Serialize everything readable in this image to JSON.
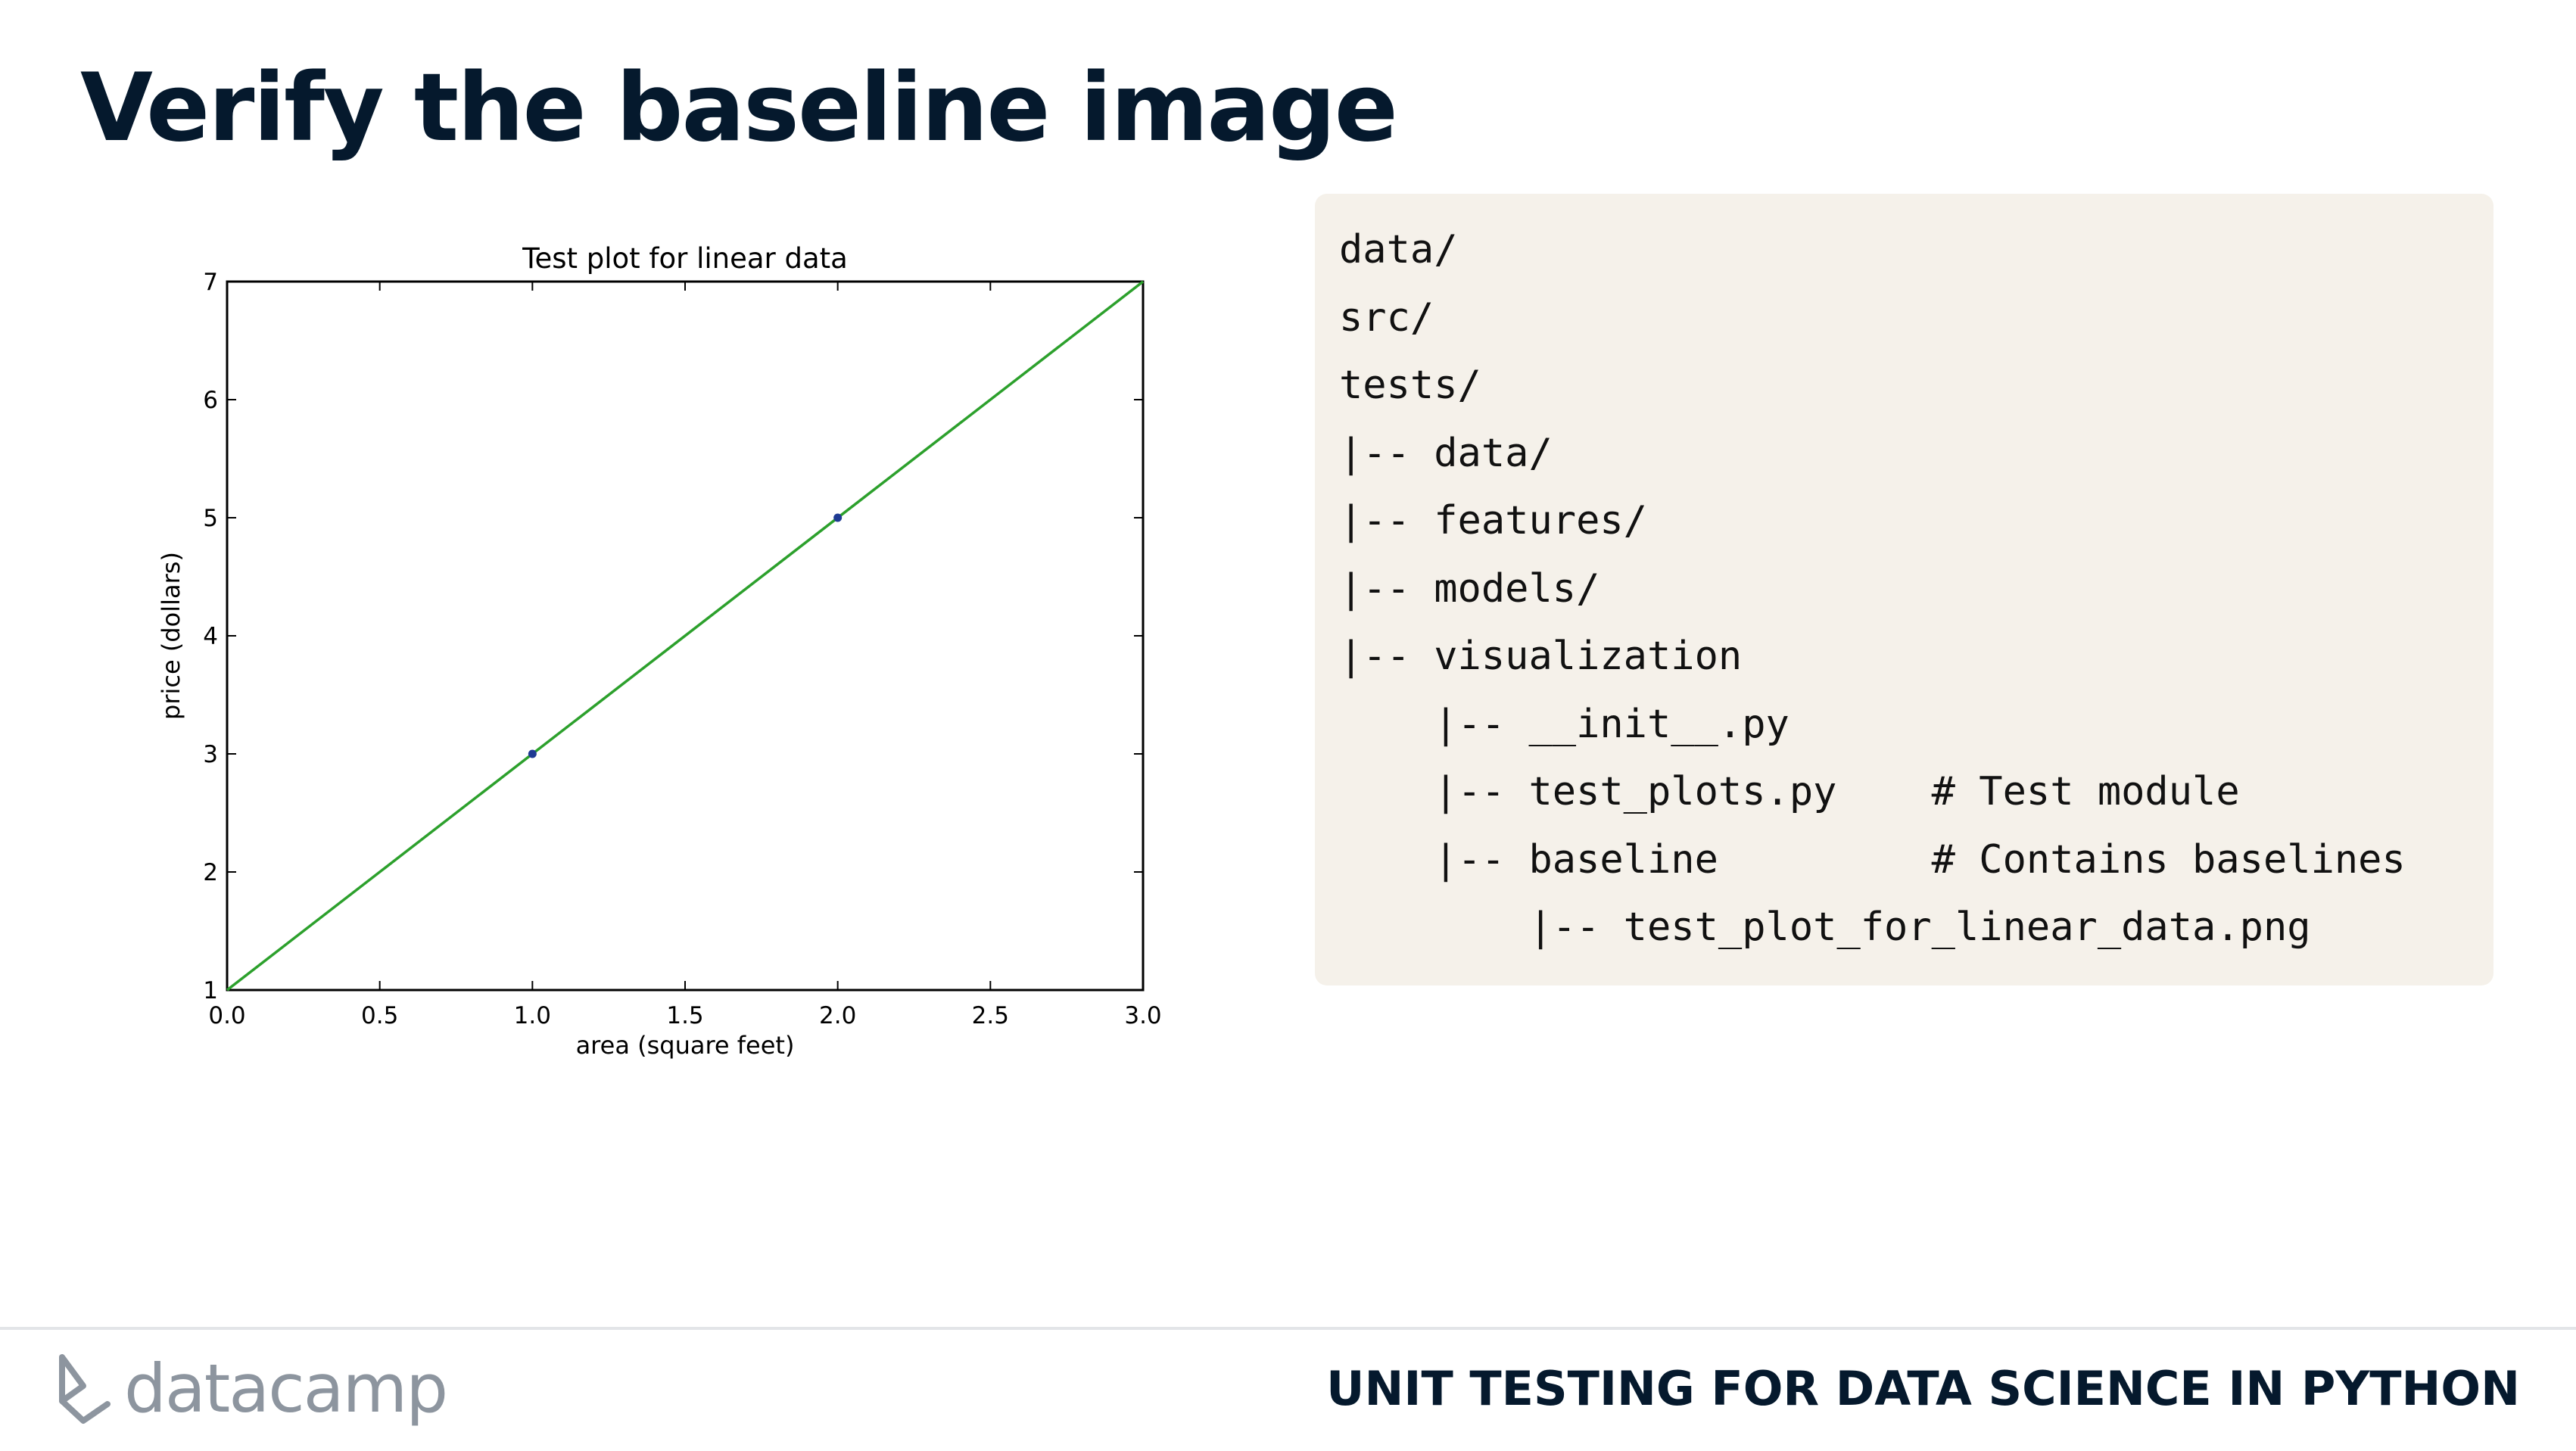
{
  "slide": {
    "title": "Verify the baseline image",
    "course_title": "UNIT TESTING FOR DATA SCIENCE IN PYTHON",
    "logo_text": "datacamp"
  },
  "code": {
    "lines": [
      "data/",
      "src/",
      "tests/",
      "|-- data/",
      "|-- features/",
      "|-- models/",
      "|-- visualization",
      "    |-- __init__.py",
      "    |-- test_plots.py    # Test module",
      "    |-- baseline         # Contains baselines",
      "        |-- test_plot_for_linear_data.png"
    ]
  },
  "colors": {
    "title": "#05192d",
    "code_background": "#f5f1ea",
    "line": "#2ca02c",
    "points": "#1f3a93",
    "logo": "#8d959f"
  },
  "chart_data": {
    "type": "line",
    "title": "Test plot for linear data",
    "xlabel": "area (square feet)",
    "ylabel": "price (dollars)",
    "xlim": [
      0,
      3
    ],
    "ylim": [
      1,
      7
    ],
    "x_ticks": [
      "0.0",
      "0.5",
      "1.0",
      "1.5",
      "2.0",
      "2.5",
      "3.0"
    ],
    "y_ticks": [
      "1",
      "2",
      "3",
      "4",
      "5",
      "6",
      "7"
    ],
    "grid": false,
    "series": [
      {
        "type": "line",
        "x": [
          0,
          3
        ],
        "y": [
          1,
          7
        ],
        "color": "#2ca02c"
      },
      {
        "type": "scatter",
        "x": [
          1,
          2
        ],
        "y": [
          3,
          5
        ],
        "color": "#1f3a93"
      }
    ]
  }
}
